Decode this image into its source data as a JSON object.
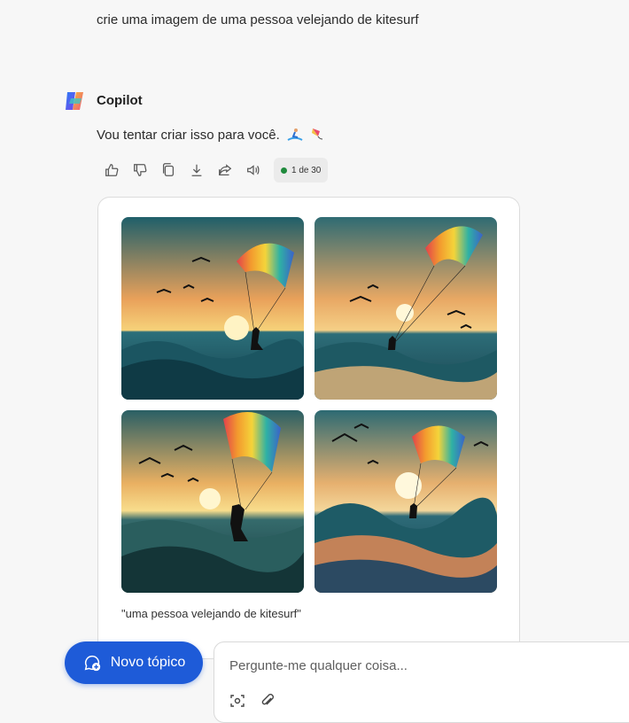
{
  "conversation": {
    "user_prompt": "crie uma imagem de uma pessoa velejando de kitesurf",
    "bot_name": "Copilot",
    "bot_reply": "Vou tentar criar isso para você.",
    "counter": "1 de 30"
  },
  "actions": [
    "thumbs-up-icon",
    "thumbs-down-icon",
    "copy-icon",
    "download-icon",
    "share-icon",
    "speaker-icon"
  ],
  "images": {
    "count": 4,
    "caption": "\"uma pessoa velejando de kitesurf\""
  },
  "composer": {
    "new_topic_label": "Novo tópico",
    "placeholder": "Pergunte-me qualquer coisa..."
  },
  "colors": {
    "accent": "#1e5bd8",
    "status_dot": "#1f8a3c"
  }
}
